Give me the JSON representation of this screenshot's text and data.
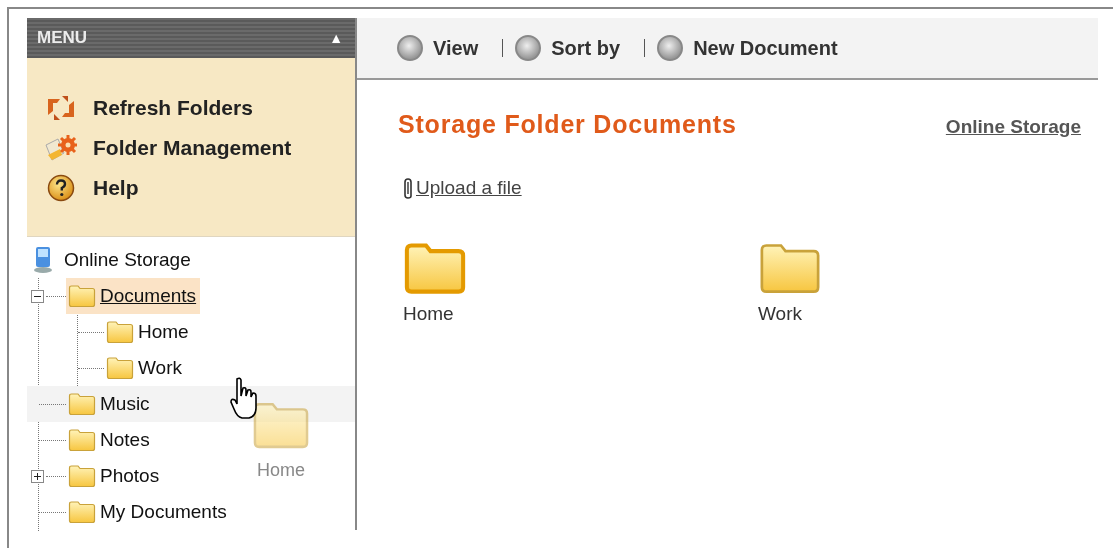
{
  "menu": {
    "title": "MENU",
    "collapse_glyph": "▲",
    "items": [
      {
        "label": "Refresh Folders",
        "kind": "refresh"
      },
      {
        "label": "Folder Management",
        "kind": "manage"
      },
      {
        "label": "Help",
        "kind": "help"
      }
    ]
  },
  "tree": {
    "root": "Online Storage",
    "items": [
      {
        "label": "Documents",
        "selected": true,
        "hovered": false,
        "expanded": true,
        "children": [
          {
            "label": "Home",
            "selected": false,
            "hovered": false
          },
          {
            "label": "Work",
            "selected": false,
            "hovered": false
          }
        ]
      },
      {
        "label": "Music",
        "selected": false,
        "hovered": true
      },
      {
        "label": "Notes",
        "selected": false,
        "hovered": false
      },
      {
        "label": "Photos",
        "selected": false,
        "hovered": false,
        "expanded": false
      },
      {
        "label": "My Documents",
        "selected": false,
        "hovered": false
      }
    ]
  },
  "drag_preview": {
    "label": "Home"
  },
  "toolbar": {
    "buttons": [
      "View",
      "Sort by",
      "New Document"
    ]
  },
  "content": {
    "title": "Storage Folder Documents",
    "breadcrumb": "Online Storage",
    "upload": "Upload a file",
    "folders": [
      {
        "label": "Home",
        "selected": true
      },
      {
        "label": "Work",
        "selected": false
      }
    ]
  }
}
